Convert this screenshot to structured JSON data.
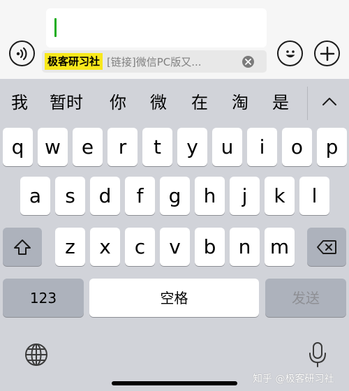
{
  "input": {
    "quote_author": "极客研习社",
    "quote_text": "[链接]微信PC版又..."
  },
  "icons": {
    "voice": "voice-wave-icon",
    "emoji": "smiley-face-icon",
    "plus": "plus-icon",
    "close": "close-x-icon",
    "collapse": "chevron-up-icon",
    "shift": "shift-arrow-icon",
    "backspace": "backspace-icon",
    "globe": "globe-icon",
    "mic": "microphone-icon"
  },
  "candidates": [
    "我",
    "暂时",
    "你",
    "微",
    "在",
    "淘",
    "是"
  ],
  "keyboard": {
    "row1": [
      "q",
      "w",
      "e",
      "r",
      "t",
      "y",
      "u",
      "i",
      "o",
      "p"
    ],
    "row2": [
      "a",
      "s",
      "d",
      "f",
      "g",
      "h",
      "j",
      "k",
      "l"
    ],
    "row3": [
      "z",
      "x",
      "c",
      "v",
      "b",
      "n",
      "m"
    ],
    "numbers_label": "123",
    "space_label": "空格",
    "send_label": "发送"
  },
  "colors": {
    "caret": "#1aad19",
    "quote_highlight": "#f8e81c",
    "keyboard_bg": "#d1d3d9",
    "dark_key": "#adb2bc"
  },
  "watermark": "知乎 @极客研习社"
}
